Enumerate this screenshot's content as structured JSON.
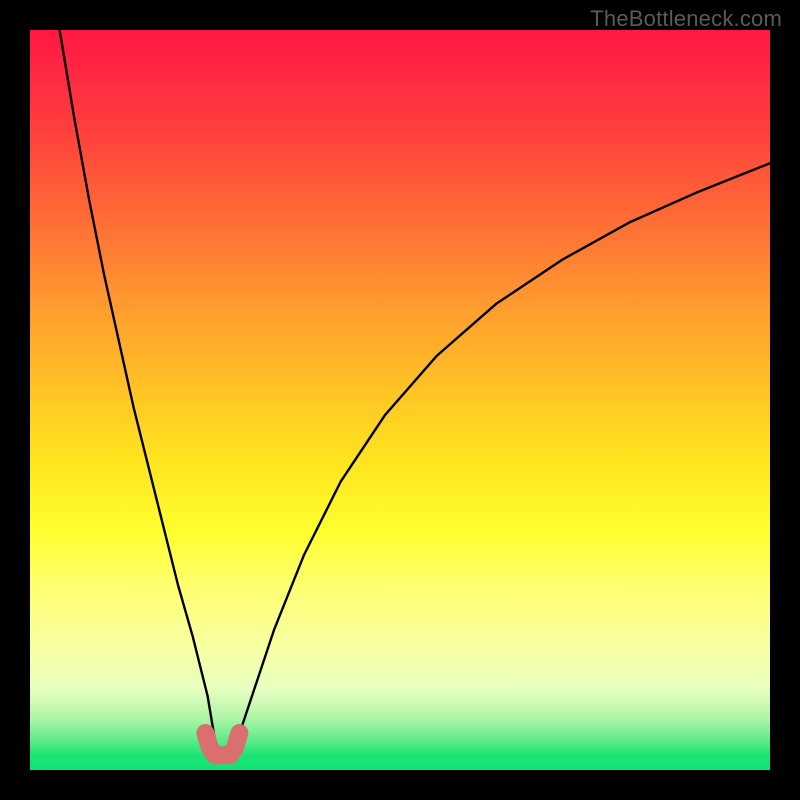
{
  "watermark": "TheBottleneck.com",
  "chart_data": {
    "type": "line",
    "title": "",
    "xlabel": "",
    "ylabel": "",
    "xlim": [
      0,
      100
    ],
    "ylim": [
      0,
      100
    ],
    "grid": false,
    "legend": false,
    "series": [
      {
        "name": "bottleneck-curve",
        "x": [
          4,
          6,
          8,
          10,
          12,
          14,
          16,
          18,
          20,
          22,
          24,
          25,
          26,
          27,
          28,
          30,
          33,
          37,
          42,
          48,
          55,
          63,
          72,
          81,
          90,
          100
        ],
        "values": [
          100,
          88,
          77,
          67,
          58,
          49,
          41,
          33,
          25,
          18,
          10,
          4,
          2,
          2,
          4,
          10,
          19,
          29,
          39,
          48,
          56,
          63,
          69,
          74,
          78,
          82
        ]
      },
      {
        "name": "highlight-segment",
        "x": [
          23.7,
          24.3,
          25.0,
          25.7,
          26.3,
          27.0,
          27.7,
          28.3
        ],
        "values": [
          5.0,
          3.0,
          2.0,
          2.0,
          2.0,
          2.0,
          3.0,
          5.0
        ]
      }
    ],
    "colors": {
      "curve": "#000000",
      "highlight": "#d9706f"
    }
  }
}
